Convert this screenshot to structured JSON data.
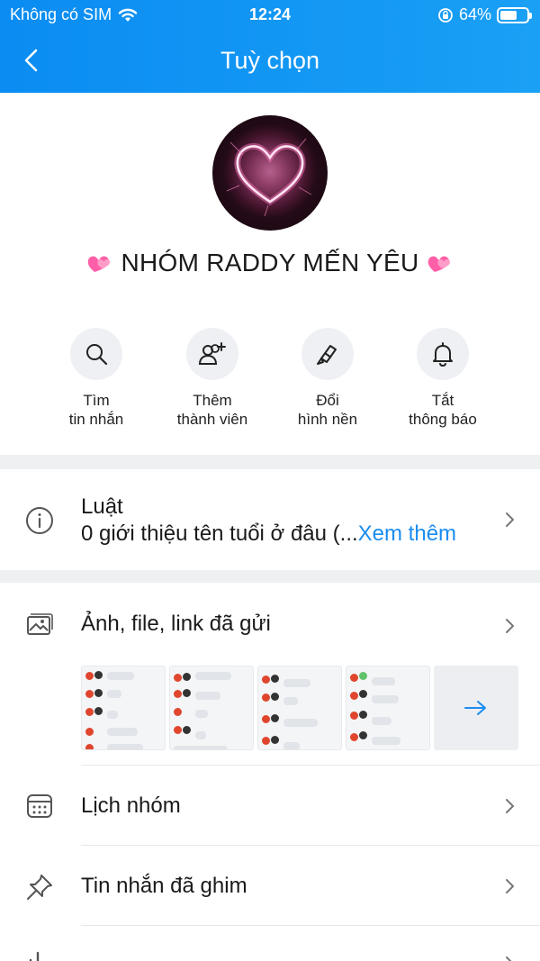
{
  "status_bar": {
    "carrier": "Không có SIM",
    "time": "12:24",
    "battery": "64%",
    "battery_level": 0.64
  },
  "nav": {
    "title": "Tuỳ chọn"
  },
  "group": {
    "name": "NHÓM RADDY MẾN YÊU"
  },
  "actions": [
    {
      "line1": "Tìm",
      "line2": "tin nhắn",
      "icon": "search-icon"
    },
    {
      "line1": "Thêm",
      "line2": "thành viên",
      "icon": "add-member-icon"
    },
    {
      "line1": "Đổi",
      "line2": "hình nền",
      "icon": "paint-brush-icon"
    },
    {
      "line1": "Tắt",
      "line2": "thông báo",
      "icon": "bell-icon"
    }
  ],
  "rules": {
    "title": "Luật",
    "text": "0 giới thiệu tên tuổi ở đâu (...",
    "more": "Xem thêm"
  },
  "media": {
    "title": "Ảnh, file, link đã gửi"
  },
  "calendar": {
    "title": "Lịch nhóm"
  },
  "pinned": {
    "title": "Tin nhắn đã ghim"
  },
  "colors": {
    "header": "#0a8cf2",
    "link": "#1a8cf0",
    "icon_bg": "#eef0f3"
  }
}
